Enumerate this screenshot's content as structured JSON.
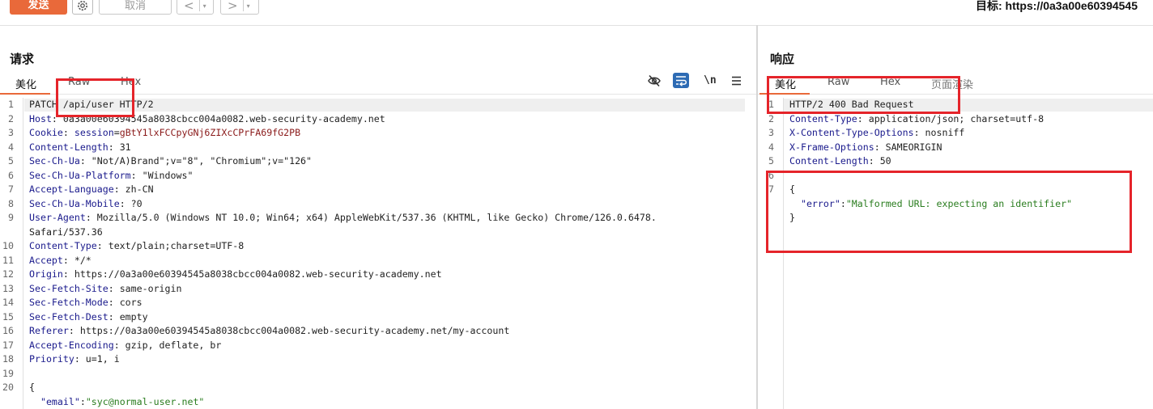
{
  "toolbar": {
    "send_label": "发送",
    "cancel_label": "取消",
    "back_arrow": "<",
    "forward_arrow": ">",
    "dropdown_glyph": "▾",
    "target_label": "目标: https://0a3a00e60394545"
  },
  "request": {
    "title": "请求",
    "tabs": [
      "美化",
      "Raw",
      "Hex"
    ],
    "active_tab": 0,
    "icons": [
      "hide-eye-icon",
      "wrap-lines-icon",
      "newline-toggle-icon",
      "menu-icon"
    ],
    "newline_icon_text": "\\n",
    "lines": [
      {
        "n": "1",
        "parts": [
          {
            "t": "PATCH /api/user HTTP/2",
            "c": "hv"
          }
        ]
      },
      {
        "n": "2",
        "parts": [
          {
            "t": "Host",
            "c": "hk"
          },
          {
            "t": ": 0a3a00e60394545a8038cbcc004a0082.web-security-academy.net",
            "c": "hv"
          }
        ]
      },
      {
        "n": "3",
        "parts": [
          {
            "t": "Cookie",
            "c": "hk"
          },
          {
            "t": ": ",
            "c": "hv"
          },
          {
            "t": "session",
            "c": "hk"
          },
          {
            "t": "=",
            "c": "hv"
          },
          {
            "t": "gBtY1lxFCCpyGNj6ZIXcCPrFA69fG2PB",
            "c": "ck"
          }
        ]
      },
      {
        "n": "4",
        "parts": [
          {
            "t": "Content-Length",
            "c": "hk"
          },
          {
            "t": ": 31",
            "c": "hv"
          }
        ]
      },
      {
        "n": "5",
        "parts": [
          {
            "t": "Sec-Ch-Ua",
            "c": "hk"
          },
          {
            "t": ": \"Not/A)Brand\";v=\"8\", \"Chromium\";v=\"126\"",
            "c": "hv"
          }
        ]
      },
      {
        "n": "6",
        "parts": [
          {
            "t": "Sec-Ch-Ua-Platform",
            "c": "hk"
          },
          {
            "t": ": \"Windows\"",
            "c": "hv"
          }
        ]
      },
      {
        "n": "7",
        "parts": [
          {
            "t": "Accept-Language",
            "c": "hk"
          },
          {
            "t": ": zh-CN",
            "c": "hv"
          }
        ]
      },
      {
        "n": "8",
        "parts": [
          {
            "t": "Sec-Ch-Ua-Mobile",
            "c": "hk"
          },
          {
            "t": ": ?0",
            "c": "hv"
          }
        ]
      },
      {
        "n": "9",
        "parts": [
          {
            "t": "User-Agent",
            "c": "hk"
          },
          {
            "t": ": Mozilla/5.0 (Windows NT 10.0; Win64; x64) AppleWebKit/537.36 (KHTML, like Gecko) Chrome/126.0.6478.",
            "c": "hv"
          }
        ]
      },
      {
        "n": "",
        "parts": [
          {
            "t": "Safari/537.36",
            "c": "hv"
          }
        ]
      },
      {
        "n": "10",
        "parts": [
          {
            "t": "Content-Type",
            "c": "hk"
          },
          {
            "t": ": text/plain;charset=UTF-8",
            "c": "hv"
          }
        ]
      },
      {
        "n": "11",
        "parts": [
          {
            "t": "Accept",
            "c": "hk"
          },
          {
            "t": ": */*",
            "c": "hv"
          }
        ]
      },
      {
        "n": "12",
        "parts": [
          {
            "t": "Origin",
            "c": "hk"
          },
          {
            "t": ": https://0a3a00e60394545a8038cbcc004a0082.web-security-academy.net",
            "c": "hv"
          }
        ]
      },
      {
        "n": "13",
        "parts": [
          {
            "t": "Sec-Fetch-Site",
            "c": "hk"
          },
          {
            "t": ": same-origin",
            "c": "hv"
          }
        ]
      },
      {
        "n": "14",
        "parts": [
          {
            "t": "Sec-Fetch-Mode",
            "c": "hk"
          },
          {
            "t": ": cors",
            "c": "hv"
          }
        ]
      },
      {
        "n": "15",
        "parts": [
          {
            "t": "Sec-Fetch-Dest",
            "c": "hk"
          },
          {
            "t": ": empty",
            "c": "hv"
          }
        ]
      },
      {
        "n": "16",
        "parts": [
          {
            "t": "Referer",
            "c": "hk"
          },
          {
            "t": ": https://0a3a00e60394545a8038cbcc004a0082.web-security-academy.net/my-account",
            "c": "hv"
          }
        ]
      },
      {
        "n": "17",
        "parts": [
          {
            "t": "Accept-Encoding",
            "c": "hk"
          },
          {
            "t": ": gzip, deflate, br",
            "c": "hv"
          }
        ]
      },
      {
        "n": "18",
        "parts": [
          {
            "t": "Priority",
            "c": "hk"
          },
          {
            "t": ": u=1, i",
            "c": "hv"
          }
        ]
      },
      {
        "n": "19",
        "parts": []
      },
      {
        "n": "20",
        "parts": [
          {
            "t": "{",
            "c": "hv"
          }
        ]
      },
      {
        "n": "",
        "parts": [
          {
            "t": "  ",
            "c": "hv"
          },
          {
            "t": "\"email\"",
            "c": "js-key"
          },
          {
            "t": ":",
            "c": "hv"
          },
          {
            "t": "\"syc@normal-user.net\"",
            "c": "js-str"
          }
        ]
      }
    ]
  },
  "response": {
    "title": "响应",
    "tabs": [
      "美化",
      "Raw",
      "Hex",
      "页面渲染"
    ],
    "active_tab": 0,
    "lines": [
      {
        "n": "1",
        "parts": [
          {
            "t": "HTTP/2 400 Bad Request",
            "c": "hv"
          }
        ]
      },
      {
        "n": "2",
        "parts": [
          {
            "t": "Content-Type",
            "c": "hk"
          },
          {
            "t": ": application/json; charset=utf-8",
            "c": "hv"
          }
        ]
      },
      {
        "n": "3",
        "parts": [
          {
            "t": "X-Content-Type-Options",
            "c": "hk"
          },
          {
            "t": ": nosniff",
            "c": "hv"
          }
        ]
      },
      {
        "n": "4",
        "parts": [
          {
            "t": "X-Frame-Options",
            "c": "hk"
          },
          {
            "t": ": SAMEORIGIN",
            "c": "hv"
          }
        ]
      },
      {
        "n": "5",
        "parts": [
          {
            "t": "Content-Length",
            "c": "hk"
          },
          {
            "t": ": 50",
            "c": "hv"
          }
        ]
      },
      {
        "n": "6",
        "parts": []
      },
      {
        "n": "7",
        "parts": [
          {
            "t": "{",
            "c": "hv"
          }
        ]
      },
      {
        "n": "",
        "parts": [
          {
            "t": "  ",
            "c": "hv"
          },
          {
            "t": "\"error\"",
            "c": "js-key"
          },
          {
            "t": ":",
            "c": "hv"
          },
          {
            "t": "\"Malformed URL: expecting an identifier\"",
            "c": "js-str"
          }
        ]
      },
      {
        "n": "",
        "parts": [
          {
            "t": "}",
            "c": "hv"
          }
        ]
      }
    ]
  },
  "colors": {
    "accent": "#e9693a",
    "highlight_box": "#e5242a",
    "header_key": "#1a1a8c",
    "json_string": "#2a7d1f",
    "cookie_value": "#8a1a1a"
  }
}
